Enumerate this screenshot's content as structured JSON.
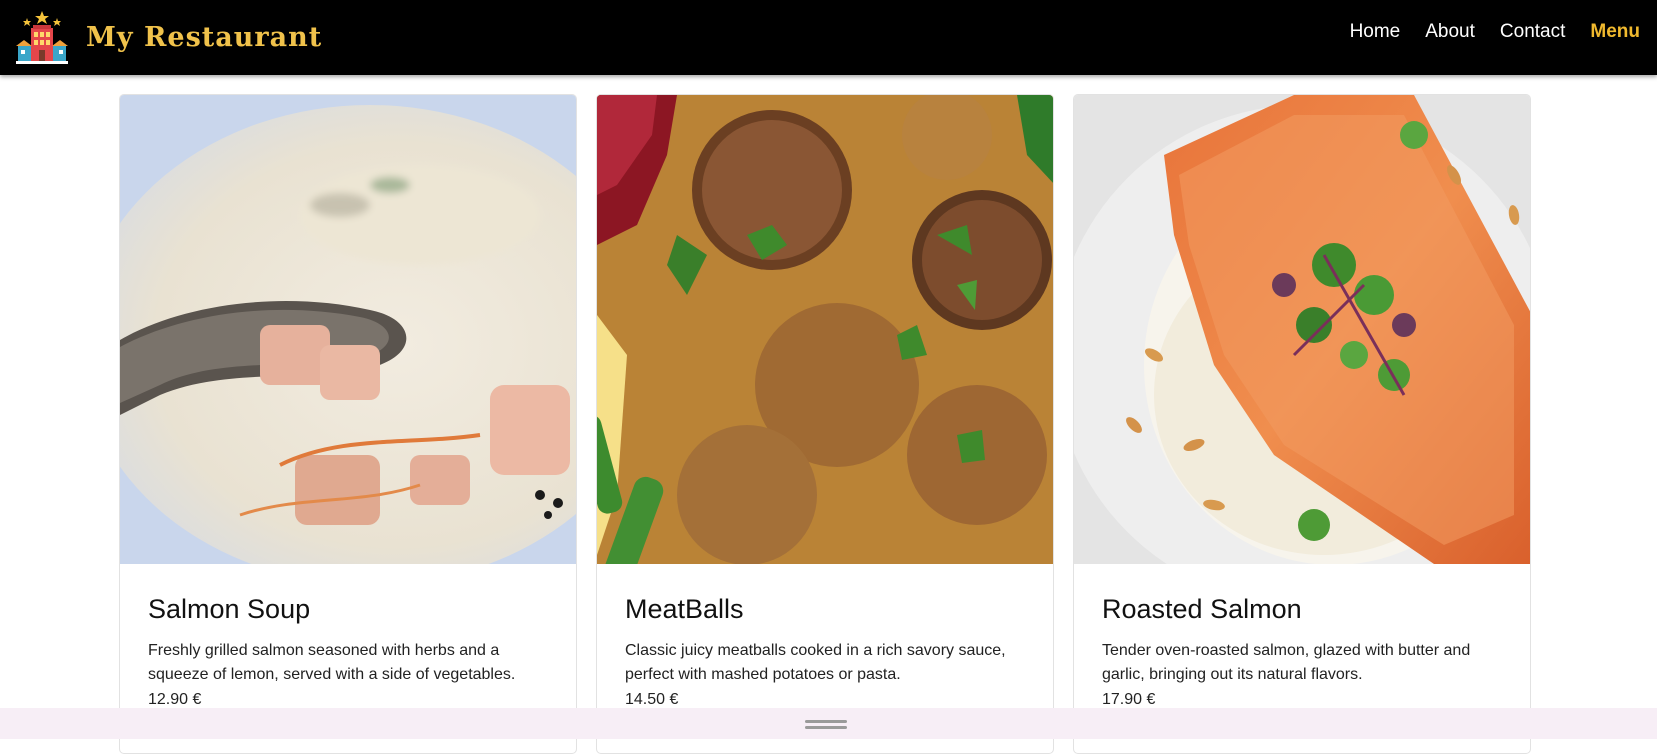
{
  "brand": {
    "name": "My Restaurant",
    "logo_icon": "restaurant-building-icon"
  },
  "nav": {
    "links": [
      "Home",
      "About",
      "Contact",
      "Menu"
    ],
    "active": "Menu"
  },
  "colors": {
    "brand": "#f0c24b",
    "active_link": "#f0b92e",
    "navbar": "#000000",
    "bottom_bar": "#f7eef6"
  },
  "menu": {
    "items": [
      {
        "title": "Salmon Soup",
        "description": "Freshly grilled salmon seasoned with herbs and a squeeze of lemon, served with a side of vegetables.",
        "price": "12.90 €",
        "image": "salmon-soup-photo"
      },
      {
        "title": "MeatBalls",
        "description": "Classic juicy meatballs cooked in a rich savory sauce, perfect with mashed potatoes or pasta.",
        "price": "14.50 €",
        "image": "meatballs-photo"
      },
      {
        "title": "Roasted Salmon",
        "description": "Tender oven-roasted salmon, glazed with butter and garlic, bringing out its natural flavors.",
        "price": "17.90 €",
        "image": "roasted-salmon-photo"
      }
    ]
  }
}
